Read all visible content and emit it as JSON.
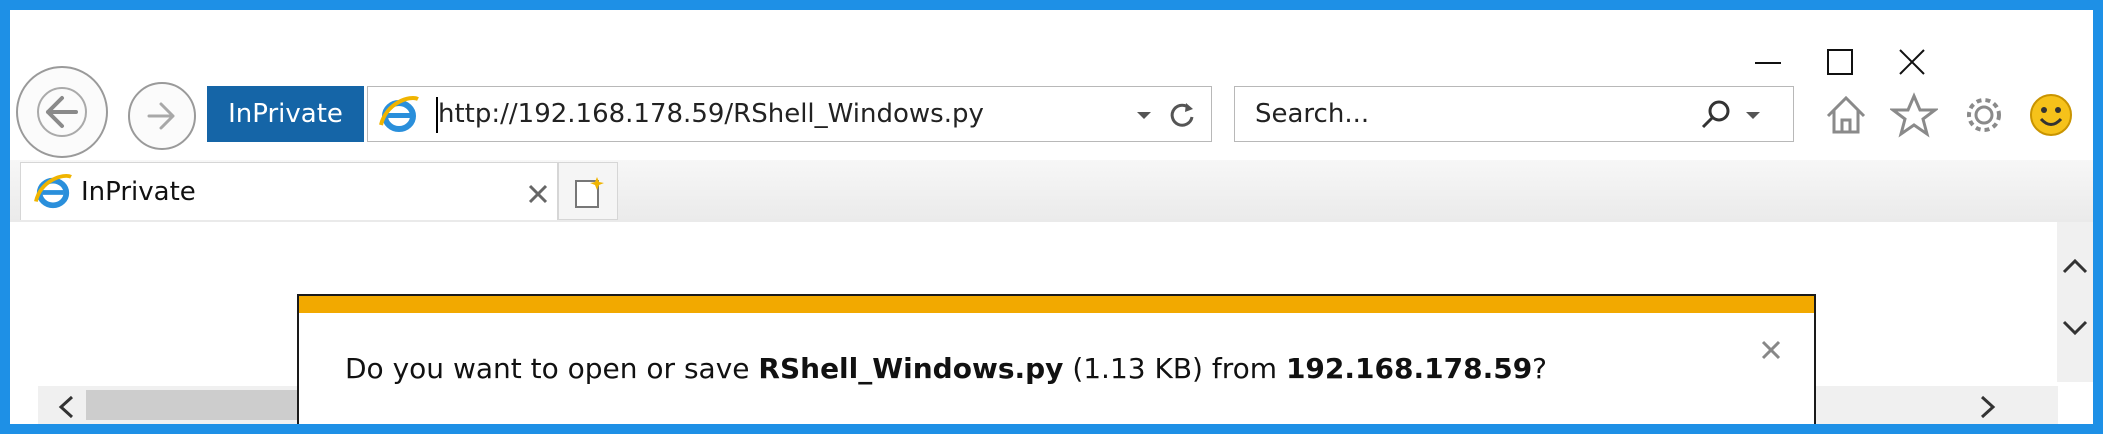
{
  "window": {
    "controls": {
      "minimize": "minimize-icon",
      "maximize": "maximize-icon",
      "close": "close-icon"
    }
  },
  "toolbar": {
    "back": "back-arrow-icon",
    "forward": "forward-arrow-icon",
    "inprivate_badge": "InPrivate",
    "address": {
      "url": "http://192.168.178.59/RShell_Windows.py",
      "icons": [
        "ie-logo-icon",
        "dropdown-arrow-icon",
        "refresh-icon"
      ]
    },
    "search": {
      "placeholder": "Search...",
      "icons": [
        "search-icon",
        "dropdown-arrow-icon"
      ]
    },
    "right_icons": [
      "home-icon",
      "favorites-star-icon",
      "settings-gear-icon",
      "smiley-feedback-icon"
    ]
  },
  "tabs": [
    {
      "label": "InPrivate",
      "icon": "ie-logo-icon"
    }
  ],
  "new_tab": "new-tab-icon",
  "scrollbars": {
    "vertical": [
      "scroll-up-icon",
      "scroll-down-icon"
    ],
    "horizontal": [
      "scroll-left-icon",
      "scroll-right-icon"
    ]
  },
  "download_bar": {
    "prefix": "Do you want to open or save ",
    "filename": "RShell_Windows.py",
    "size": " (1.13 KB) from ",
    "host": "192.168.178.59",
    "suffix": "?"
  },
  "colors": {
    "frame": "#1e90e6",
    "inprivate_badge": "#1565a7",
    "notification_accent": "#f2a900"
  }
}
